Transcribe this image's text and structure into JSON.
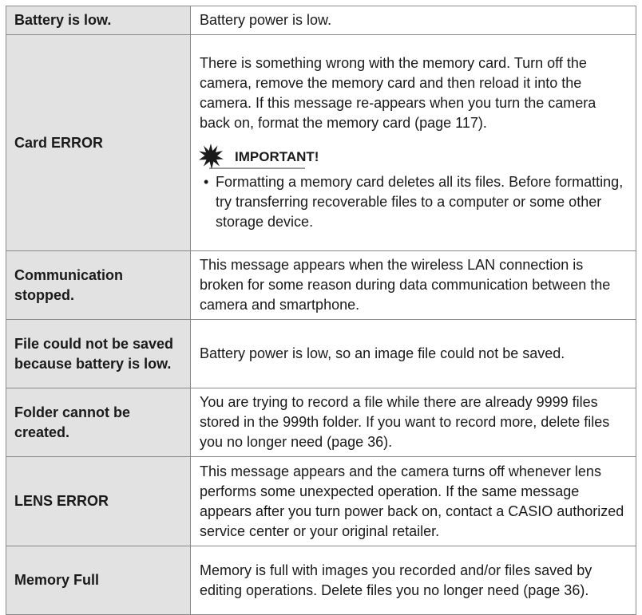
{
  "rows": [
    {
      "message": "Battery is low.",
      "description": "Battery power is low."
    },
    {
      "message": "Card ERROR",
      "description": "There is something wrong with the memory card. Turn off the camera, remove the memory card and then reload it into the camera. If this message re-appears when you turn the camera back on, format the memory card (page 117).",
      "important": {
        "title": "IMPORTANT!",
        "icon": "burst-icon",
        "bullet": "•",
        "note": "Formatting a memory card deletes all its files. Before formatting, try transferring recoverable files to a computer or some other storage device."
      }
    },
    {
      "message": "Communication stopped.",
      "description": "This message appears when the wireless LAN connection is broken for some reason during data communication between the camera and smartphone."
    },
    {
      "message": "File could not be saved because battery is low.",
      "description": "Battery power is low, so an image file could not be saved."
    },
    {
      "message": "Folder cannot be created.",
      "description": "You are trying to record a file while there are already 9999 files stored in the 999th folder. If you want to record more, delete files you no longer need (page 36)."
    },
    {
      "message": "LENS ERROR",
      "description": "This message appears and the camera turns off whenever lens performs some unexpected operation. If the same message appears after you turn power back on, contact a CASIO authorized service center or your original retailer."
    },
    {
      "message": "Memory Full",
      "description": "Memory is full with images you recorded and/or files saved by editing operations. Delete files you no longer need (page 36)."
    }
  ],
  "colors": {
    "header_cell_bg": "#e2e2e2",
    "border": "#8a8a8a",
    "text": "#1a1a1a"
  }
}
